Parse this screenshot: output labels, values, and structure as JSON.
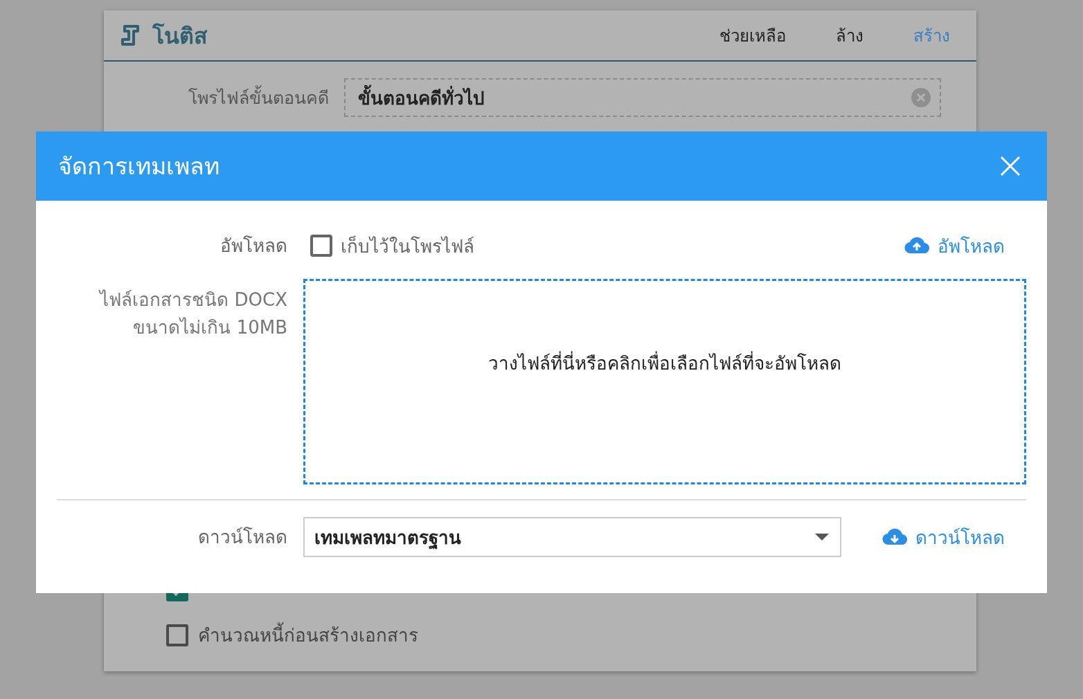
{
  "app": {
    "logo": "โนติส",
    "nav": [
      {
        "label": "ช่วยเหลือ",
        "kind": "plain"
      },
      {
        "label": "ล้าง",
        "kind": "plain"
      },
      {
        "label": "สร้าง",
        "kind": "primary"
      }
    ]
  },
  "form": {
    "profile_label": "โพรไฟล์ขั้นตอนคดี",
    "profile_value": "ขั้นตอนคดีทั่วไป",
    "options": [
      {
        "checked": true
      },
      {
        "label": "คำนวณหนี้ก่อนสร้างเอกสาร",
        "checked": false
      }
    ]
  },
  "modal": {
    "title": "จัดการเทมเพลท",
    "upload_label": "อัพโหลด",
    "keep_in_profile": {
      "label": "เก็บไว้ในโพรไฟล์",
      "checked": false
    },
    "upload_button": "อัพโหลด",
    "file_hint": [
      "ไฟล์เอกสารชนิด DOCX",
      "ขนาดไม่เกิน 10MB"
    ],
    "dropzone_text": "วางไฟล์ที่นี่หรือคลิกเพื่อเลือกไฟล์ที่จะอัพโหลด",
    "download_label": "ดาวน์โหลด",
    "template_value": "เทมเพลทมาตรฐาน",
    "download_button": "ดาวน์โหลด"
  }
}
